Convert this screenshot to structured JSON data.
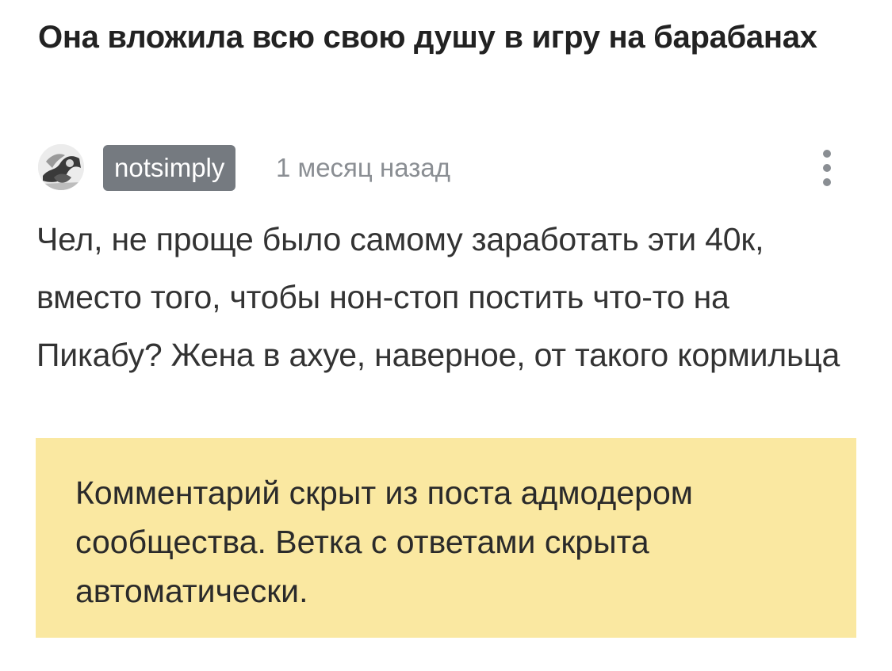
{
  "post": {
    "title": "Она вложила всю свою душу в игру на барабанах"
  },
  "comment": {
    "avatar_icon": "user-avatar-image",
    "username": "notsimply",
    "timestamp": "1 месяц назад",
    "menu_icon": "more-vertical-icon",
    "text": "Чел, не проще было самому заработать эти 40к, вместо того, чтобы нон-стоп постить что-то на Пикабу? Жена в ахуе, наверное, от такого кормильца"
  },
  "notice": {
    "text": "Комментарий скрыт из поста адмодером сообщества. Ветка с ответами скрыта автоматически.",
    "background_color": "#fae8a1"
  },
  "colors": {
    "username_badge": "#757a80",
    "muted_text": "#8a8e93"
  }
}
